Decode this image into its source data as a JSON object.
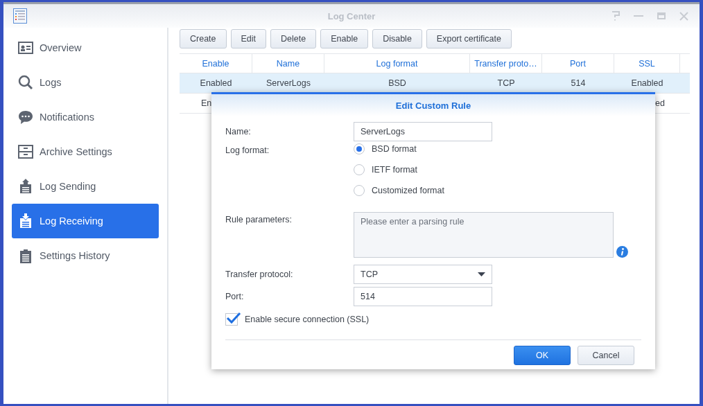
{
  "window": {
    "title": "Log Center"
  },
  "sidebar": {
    "items": [
      {
        "label": "Overview",
        "kind": "overview",
        "selected": false
      },
      {
        "label": "Logs",
        "kind": "search",
        "selected": false
      },
      {
        "label": "Notifications",
        "kind": "chat",
        "selected": false
      },
      {
        "label": "Archive Settings",
        "kind": "archive",
        "selected": false
      },
      {
        "label": "Log Sending",
        "kind": "upload",
        "selected": false
      },
      {
        "label": "Log Receiving",
        "kind": "download",
        "selected": true
      },
      {
        "label": "Settings History",
        "kind": "clipboard",
        "selected": false
      }
    ]
  },
  "toolbar": [
    "Create",
    "Edit",
    "Delete",
    "Enable",
    "Disable",
    "Export certificate"
  ],
  "table": {
    "columns": [
      "Enable",
      "Name",
      "Log format",
      "Transfer proto…",
      "Port",
      "SSL"
    ],
    "rows": [
      {
        "selected": true,
        "cells": [
          "Enabled",
          "ServerLogs",
          "BSD",
          "TCP",
          "514",
          "Enabled"
        ]
      },
      {
        "selected": false,
        "cells": [
          "En",
          "",
          "",
          "",
          "",
          "ed"
        ]
      }
    ]
  },
  "dialog": {
    "title": "Edit Custom Rule",
    "name": {
      "label": "Name:",
      "value": "ServerLogs"
    },
    "log_format": {
      "label": "Log format:",
      "options": [
        {
          "label": "BSD format",
          "selected": true
        },
        {
          "label": "IETF format",
          "selected": false
        },
        {
          "label": "Customized format",
          "selected": false
        }
      ]
    },
    "rule_parameters": {
      "label": "Rule parameters:",
      "placeholder": "Please enter a parsing rule"
    },
    "transfer_protocol": {
      "label": "Transfer protocol:",
      "value": "TCP"
    },
    "port": {
      "label": "Port:",
      "value": "514"
    },
    "ssl": {
      "label": "Enable secure connection (SSL)",
      "checked": true
    },
    "buttons": [
      {
        "label": "OK",
        "kind": "primary"
      },
      {
        "label": "Cancel",
        "kind": "secondary"
      }
    ]
  }
}
